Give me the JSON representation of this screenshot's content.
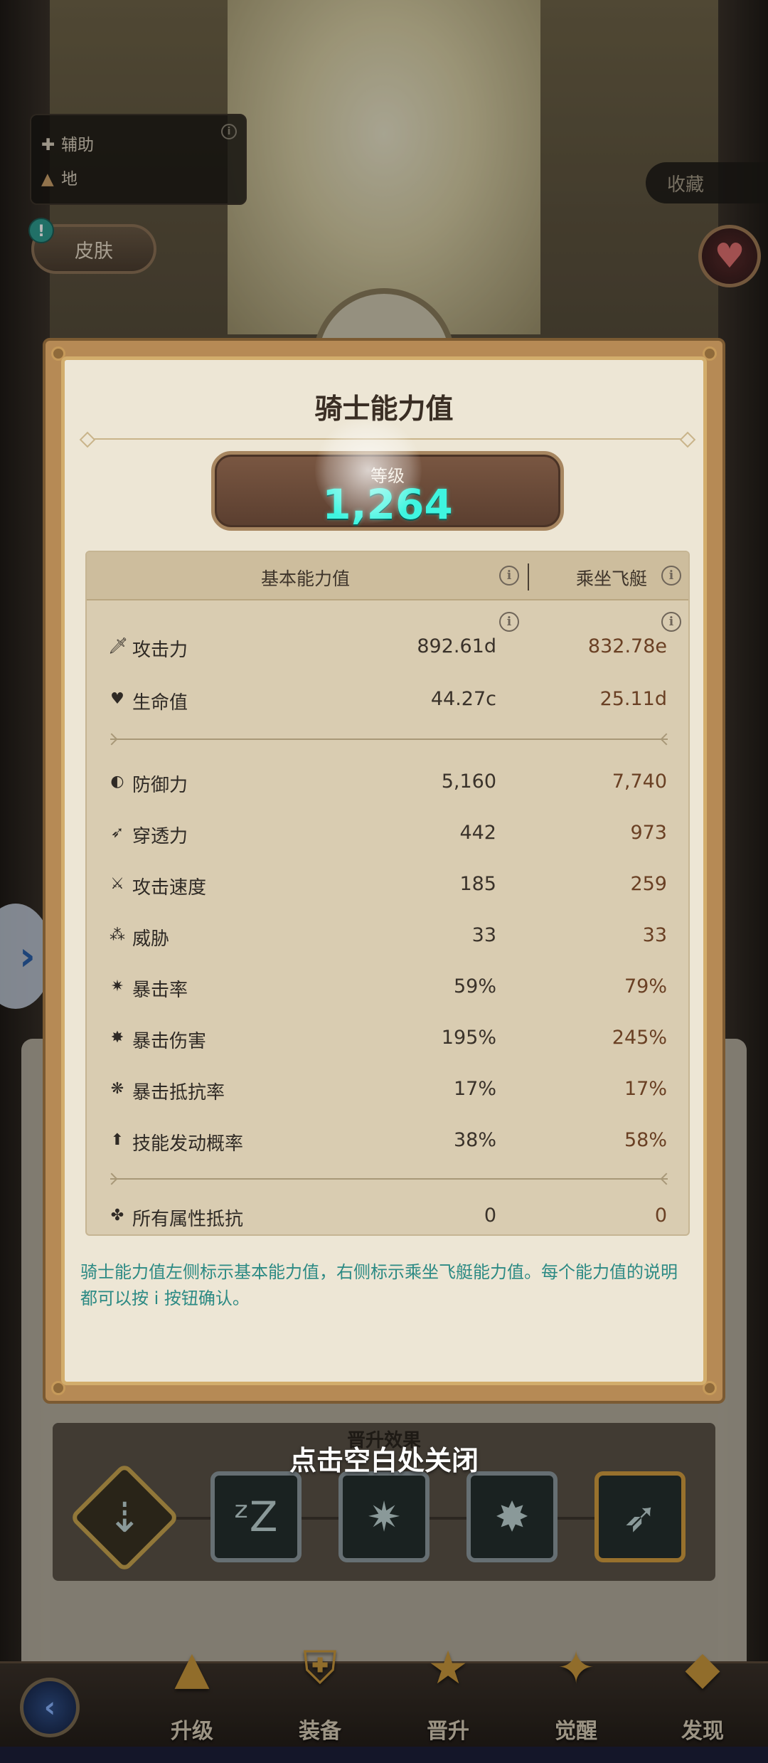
{
  "background": {
    "info_box": {
      "row1": "辅助",
      "row2": "地"
    },
    "skin_button": "皮肤",
    "skin_alert": "!",
    "favorite_button": "收藏"
  },
  "modal": {
    "title": "骑士能力值",
    "level_label": "等级",
    "level_value": "1,264",
    "headers": {
      "base": "基本能力值",
      "mount": "乘坐飞艇"
    },
    "stats": [
      {
        "name": "攻击力",
        "base": "892.61d",
        "mount": "832.78e",
        "icon": "sword-icon"
      },
      {
        "name": "生命值",
        "base": "44.27c",
        "mount": "25.11d",
        "icon": "heart-plus-icon"
      },
      {
        "name": "防御力",
        "base": "5,160",
        "mount": "7,740",
        "icon": "shield-icon"
      },
      {
        "name": "穿透力",
        "base": "442",
        "mount": "973",
        "icon": "pierce-icon"
      },
      {
        "name": "攻击速度",
        "base": "185",
        "mount": "259",
        "icon": "attack-speed-icon"
      },
      {
        "name": "威胁",
        "base": "33",
        "mount": "33",
        "icon": "threat-icon"
      },
      {
        "name": "暴击率",
        "base": "59%",
        "mount": "79%",
        "icon": "crit-rate-icon"
      },
      {
        "name": "暴击伤害",
        "base": "195%",
        "mount": "245%",
        "icon": "crit-damage-icon"
      },
      {
        "name": "暴击抵抗率",
        "base": "17%",
        "mount": "17%",
        "icon": "crit-resist-icon"
      },
      {
        "name": "技能发动概率",
        "base": "38%",
        "mount": "58%",
        "icon": "skill-proc-icon"
      },
      {
        "name": "所有属性抵抗",
        "base": "0",
        "mount": "0",
        "icon": "all-resist-icon"
      }
    ],
    "note": "骑士能力值左侧标示基本能力值，右侧标示乘坐飞艇能力值。每个能力值的说明都可以按 i 按钮确认。"
  },
  "promotion": {
    "title": "晋升效果"
  },
  "close_hint": "点击空白处关闭",
  "nav": {
    "items": [
      {
        "label": "升级",
        "icon": "upgrade-icon"
      },
      {
        "label": "装备",
        "icon": "equipment-icon"
      },
      {
        "label": "晋升",
        "icon": "promotion-icon"
      },
      {
        "label": "觉醒",
        "icon": "awaken-icon"
      },
      {
        "label": "发现",
        "icon": "discover-icon"
      }
    ]
  },
  "colors": {
    "level_value": "#3ff5e0",
    "note_text": "#2c8a84",
    "mount_value": "#6a4024"
  }
}
